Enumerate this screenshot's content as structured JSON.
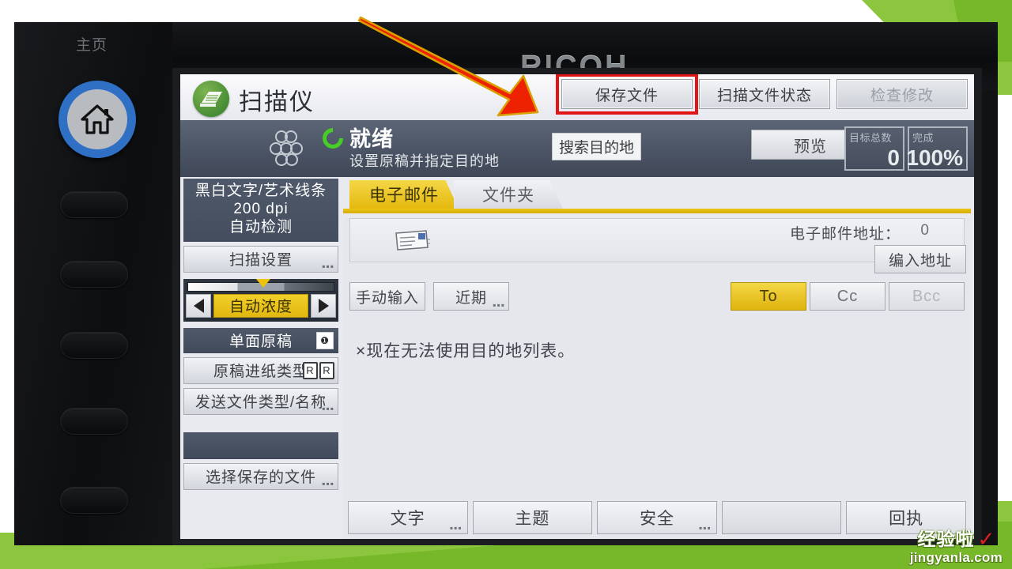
{
  "device": {
    "brand": "RICOH",
    "home_label": "主页",
    "home_icon": "home-icon"
  },
  "screen": {
    "app_title": "扫描仪",
    "app_icon": "scanner-icon",
    "toolbar": [
      {
        "label": "保存文件",
        "highlighted": true,
        "dim": false
      },
      {
        "label": "扫描文件状态",
        "highlighted": false,
        "dim": false
      },
      {
        "label": "检查修改",
        "highlighted": false,
        "dim": true
      }
    ],
    "status": {
      "ready_text": "就绪",
      "ready_sub": "设置原稿并指定目的地",
      "ready_icon": "ready-spinner-icon",
      "dots_icon": "job-dots-icon",
      "search_destination": "搜索目的地",
      "preview": "预览",
      "counters": [
        {
          "label": "目标总数",
          "value": "0"
        },
        {
          "label": "完成",
          "value": "100%"
        }
      ]
    },
    "sidebar": {
      "info_lines": [
        "黑白文字/艺术线条",
        "200 dpi",
        "自动检测"
      ],
      "scan_settings": "扫描设置",
      "density": {
        "label": "自动浓度",
        "left_arrow": "left-arrow-icon",
        "right_arrow": "right-arrow-icon"
      },
      "original_side": "单面原稿",
      "original_side_icon": "single-sided-icon",
      "feed_type": "原稿进纸类型",
      "feed_icons": [
        "R",
        "R"
      ],
      "file_type_name": "发送文件类型/名称",
      "select_saved_file": "选择保存的文件"
    },
    "tabs": [
      {
        "label": "电子邮件",
        "active": true
      },
      {
        "label": "文件夹",
        "active": false
      }
    ],
    "content": {
      "mail_icon": "envelope-icon",
      "address_label": "电子邮件地址：",
      "address_count": "0",
      "enter_address": "编入地址",
      "manual_input": "手动输入",
      "recent": "近期",
      "recipients": [
        {
          "label": "To",
          "state": "active"
        },
        {
          "label": "Cc",
          "state": "normal"
        },
        {
          "label": "Bcc",
          "state": "dim"
        }
      ],
      "notice": "×现在无法使用目的地列表。",
      "bottom_buttons": [
        {
          "label": "文字",
          "ellipsis": true,
          "blank": false
        },
        {
          "label": "主题",
          "ellipsis": false,
          "blank": false
        },
        {
          "label": "安全",
          "ellipsis": true,
          "blank": false
        },
        {
          "label": "",
          "ellipsis": false,
          "blank": true
        },
        {
          "label": "回执",
          "ellipsis": false,
          "blank": false
        }
      ]
    }
  },
  "annotation": {
    "arrow_color": "#ee2200",
    "highlight_color": "#ee1111"
  },
  "watermark": {
    "brand_cn": "经验啦",
    "check": "✓",
    "url": "jingyanla.com"
  }
}
